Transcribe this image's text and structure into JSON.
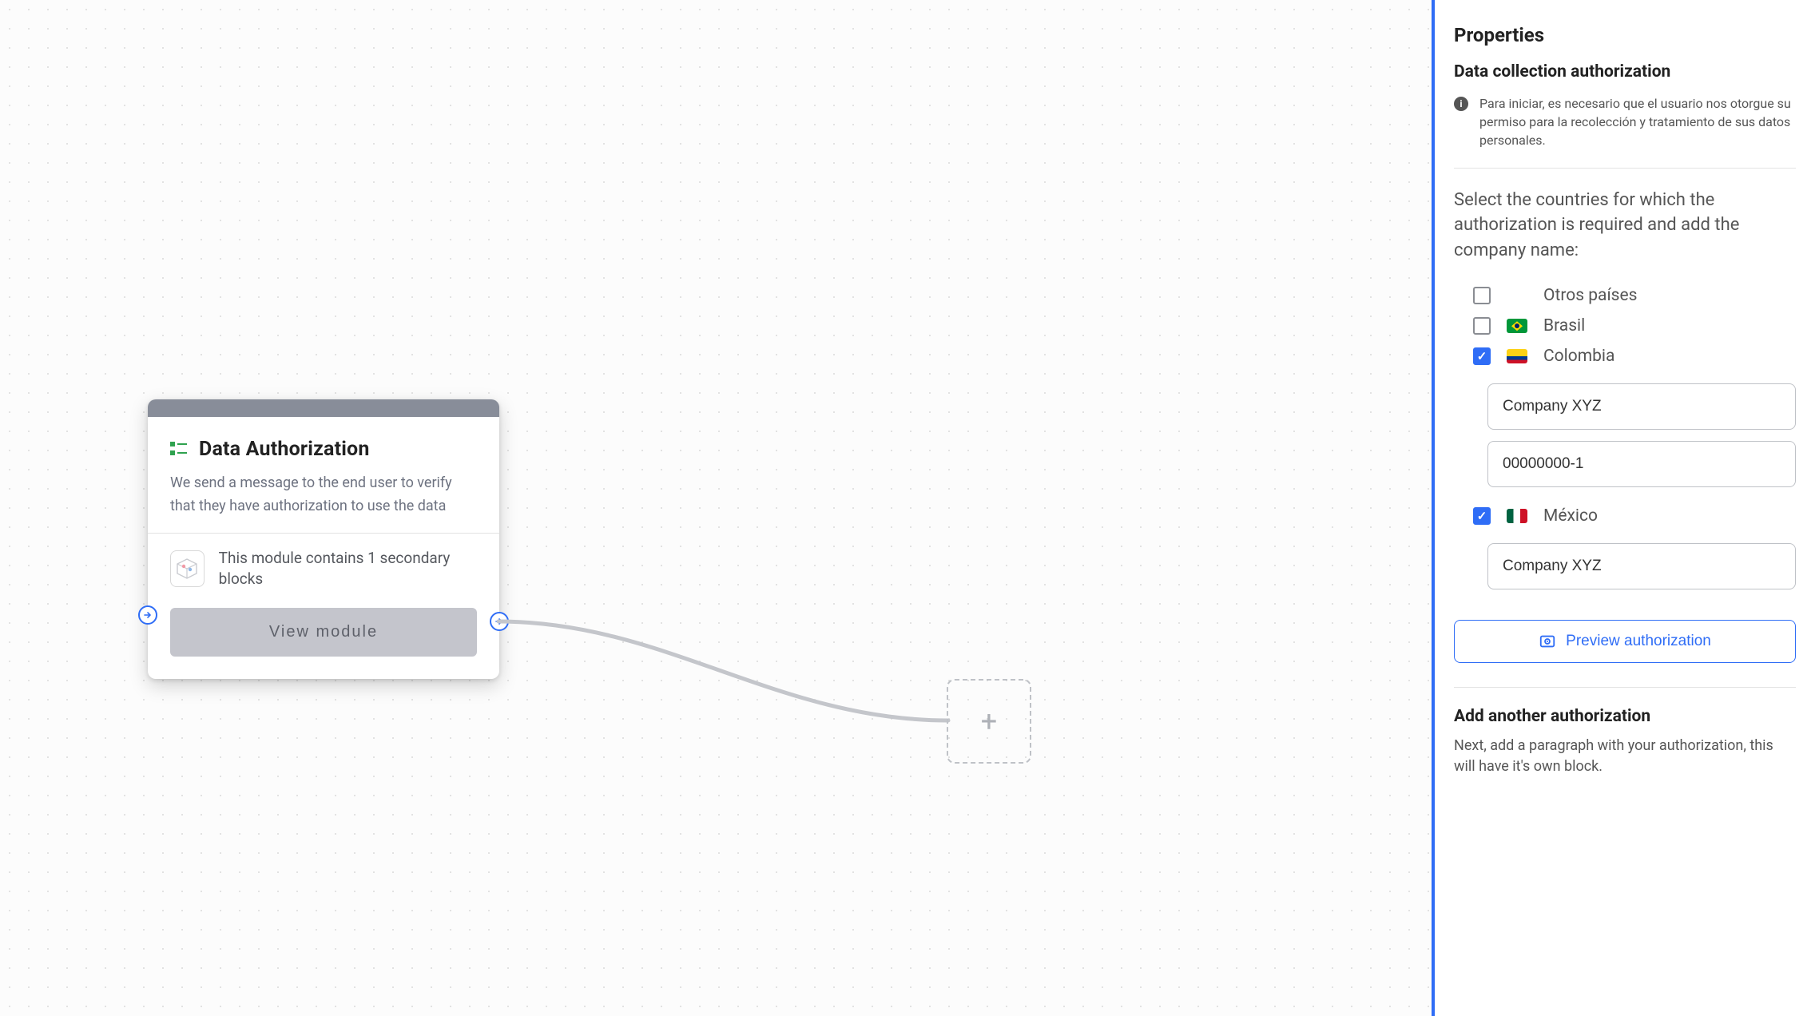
{
  "canvas": {
    "node": {
      "title": "Data Authorization",
      "description": "We send a message to the end user to verify that they have authorization to use the data",
      "module_info": "This module contains 1 secondary blocks",
      "view_module_label": "View module"
    },
    "add_node_glyph": "+"
  },
  "sidebar": {
    "properties_title": "Properties",
    "subtitle": "Data collection authorization",
    "info_text": "Para iniciar, es necesario que el usuario nos otorgue su permiso para la recolección y tratamiento de sus datos personales.",
    "instruction": "Select the countries for which the authorization is required and add the company name:",
    "countries": [
      {
        "key": "other",
        "label": "Otros países",
        "checked": false,
        "flag": null
      },
      {
        "key": "brasil",
        "label": "Brasil",
        "checked": false,
        "flag": "br"
      },
      {
        "key": "colombia",
        "label": "Colombia",
        "checked": true,
        "flag": "co",
        "fields": {
          "company": "Company XYZ",
          "tax_id": "00000000-1"
        }
      },
      {
        "key": "mexico",
        "label": "México",
        "checked": true,
        "flag": "mx",
        "fields": {
          "company": "Company XYZ"
        }
      }
    ],
    "preview_label": "Preview authorization",
    "add_another": {
      "title": "Add another authorization",
      "text": "Next, add a paragraph with your authorization, this will have it's own block."
    }
  }
}
